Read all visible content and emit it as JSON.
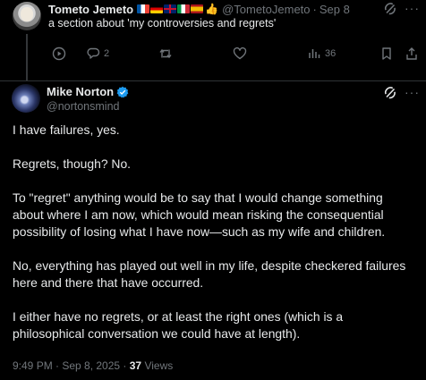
{
  "reply": {
    "display_name": "Tometo Jemeto",
    "handle": "@TometoJemeto",
    "separator": "·",
    "date": "Sep 8",
    "text": "a section about 'my controversies and regrets'",
    "actions": {
      "replies": "2",
      "reposts": "",
      "likes": "",
      "views": "36"
    }
  },
  "main_post": {
    "display_name": "Mike Norton",
    "handle": "@nortonsmind",
    "verified": true,
    "paragraphs": [
      [
        "I have failures, yes."
      ],
      [
        "Regrets, though? No."
      ],
      [
        "To \"regret\" anything would be to say that I would change something",
        "about where I am now, which would mean risking the consequential",
        "possibility of losing what I have now—such as my wife and children."
      ],
      [
        "No, everything has played out well in my life, despite checkered failures",
        "here and there that have occurred."
      ],
      [
        "I either have no regrets, or at least the right ones (which is a",
        "philosophical conversation we could have at length)."
      ]
    ],
    "meta": {
      "time_date": "9:49 PM · Sep 8, 2025 · ",
      "views_count": "37",
      "views_label": " Views"
    }
  },
  "icons": {
    "reply": "speech-bubble-icon",
    "repost": "repost-icon",
    "like": "heart-icon",
    "views": "bar-chart-icon",
    "bookmark": "bookmark-icon",
    "share": "share-icon",
    "grok": "grok-icon",
    "more": "more-dots-icon",
    "play": "play-icon",
    "verified": "verified-badge-icon"
  },
  "colors": {
    "background": "#000000",
    "text": "#e7e9ea",
    "muted": "#71767b",
    "accent": "#1d9bf0",
    "divider": "#2f3336"
  }
}
